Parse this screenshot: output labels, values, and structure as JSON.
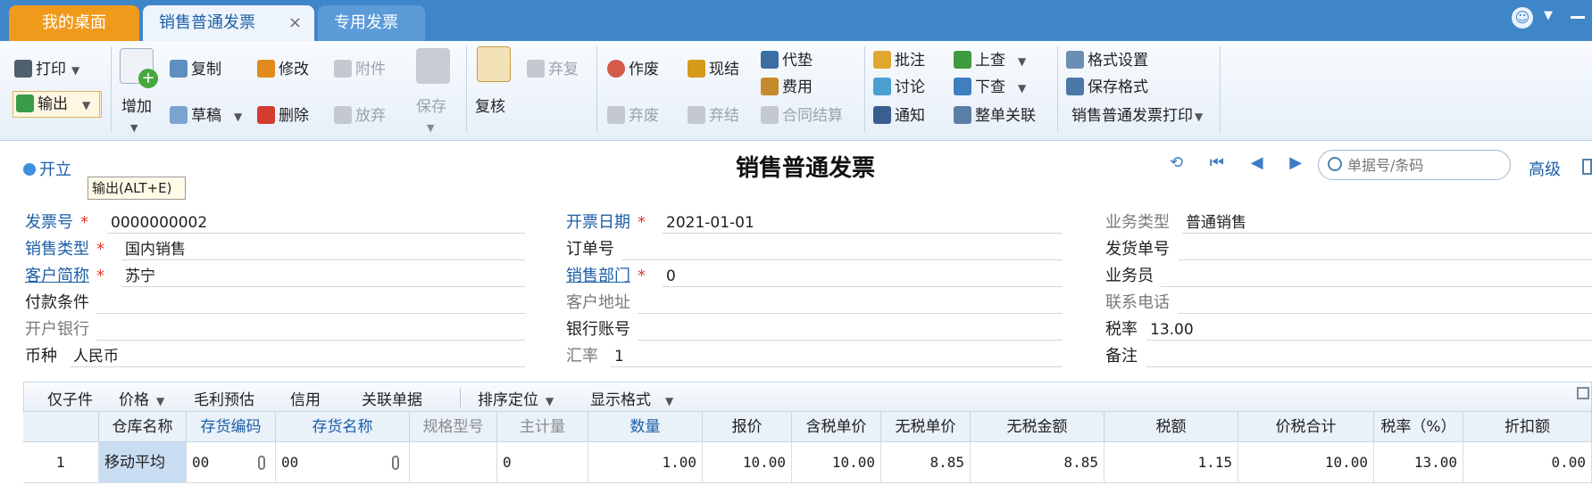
{
  "tabs": {
    "desk": "我的桌面",
    "sale": "销售普通发票",
    "close": "×",
    "special": "专用发票"
  },
  "toolbar": {
    "print": "打印",
    "export": "输出",
    "add": "增加",
    "copy": "复制",
    "draft": "草稿",
    "edit": "修改",
    "delete": "删除",
    "attach": "附件",
    "discard": "放弃",
    "save": "保存",
    "recheck": "复核",
    "abandon_restore": "弃复",
    "void": "作废",
    "void_abandon": "弃废",
    "cash_settle": "现结",
    "abandon_settle": "弃结",
    "advance": "代垫",
    "fee": "费用",
    "contract_settle": "合同结算",
    "annotate": "批注",
    "discuss": "讨论",
    "notify": "通知",
    "look_up": "上查",
    "look_down": "下查",
    "whole_link": "整单关联",
    "format_setting": "格式设置",
    "save_format": "保存格式",
    "print_template": "销售普通发票打印"
  },
  "header": {
    "open_label": "开立",
    "tooltip": "输出(ALT+E)",
    "title": "销售普通发票",
    "nav_glyphs": "⟲ ⏮ ◀ ▶ ⏭",
    "search_placeholder": "单据号/条码",
    "advanced": "高级"
  },
  "form": {
    "invoice_no": {
      "label": "发票号",
      "value": "0000000002"
    },
    "invoice_date": {
      "label": "开票日期",
      "value": "2021-01-01"
    },
    "biz_type": {
      "label": "业务类型",
      "value": "普通销售"
    },
    "sale_type": {
      "label": "销售类型",
      "value": "国内销售"
    },
    "order_no": {
      "label": "订单号",
      "value": ""
    },
    "ship_no": {
      "label": "发货单号",
      "value": ""
    },
    "customer": {
      "label": "客户简称",
      "value": "苏宁"
    },
    "sales_dept": {
      "label": "销售部门",
      "value": "0"
    },
    "salesman": {
      "label": "业务员",
      "value": ""
    },
    "pay_terms": {
      "label": "付款条件",
      "value": ""
    },
    "cust_addr": {
      "label": "客户地址",
      "value": ""
    },
    "contact_phone": {
      "label": "联系电话",
      "value": ""
    },
    "bank": {
      "label": "开户银行",
      "value": ""
    },
    "bank_account": {
      "label": "银行账号",
      "value": ""
    },
    "tax_rate": {
      "label": "税率",
      "value": "13.00"
    },
    "currency": {
      "label": "币种",
      "value": "人民币"
    },
    "exchange_rate": {
      "label": "汇率",
      "value": "1"
    },
    "remark": {
      "label": "备注",
      "value": ""
    },
    "required_mark": "*"
  },
  "grid_toolbar": {
    "only_child": "仅子件",
    "price": "价格",
    "gross_profit": "毛利预估",
    "credit": "信用",
    "linked_docs": "关联单据",
    "sort_locate": "排序定位",
    "display_format": "显示格式"
  },
  "grid": {
    "columns": [
      "",
      "仓库名称",
      "存货编码",
      "存货名称",
      "规格型号",
      "主计量",
      "数量",
      "报价",
      "含税单价",
      "无税单价",
      "无税金额",
      "税额",
      "价税合计",
      "税率（%）",
      "折扣额"
    ],
    "row": [
      "1",
      "移动平均",
      "00",
      "00",
      "",
      "0",
      "1.00",
      "10.00",
      "10.00",
      "8.85",
      "8.85",
      "1.15",
      "10.00",
      "13.00",
      "0.00"
    ]
  }
}
